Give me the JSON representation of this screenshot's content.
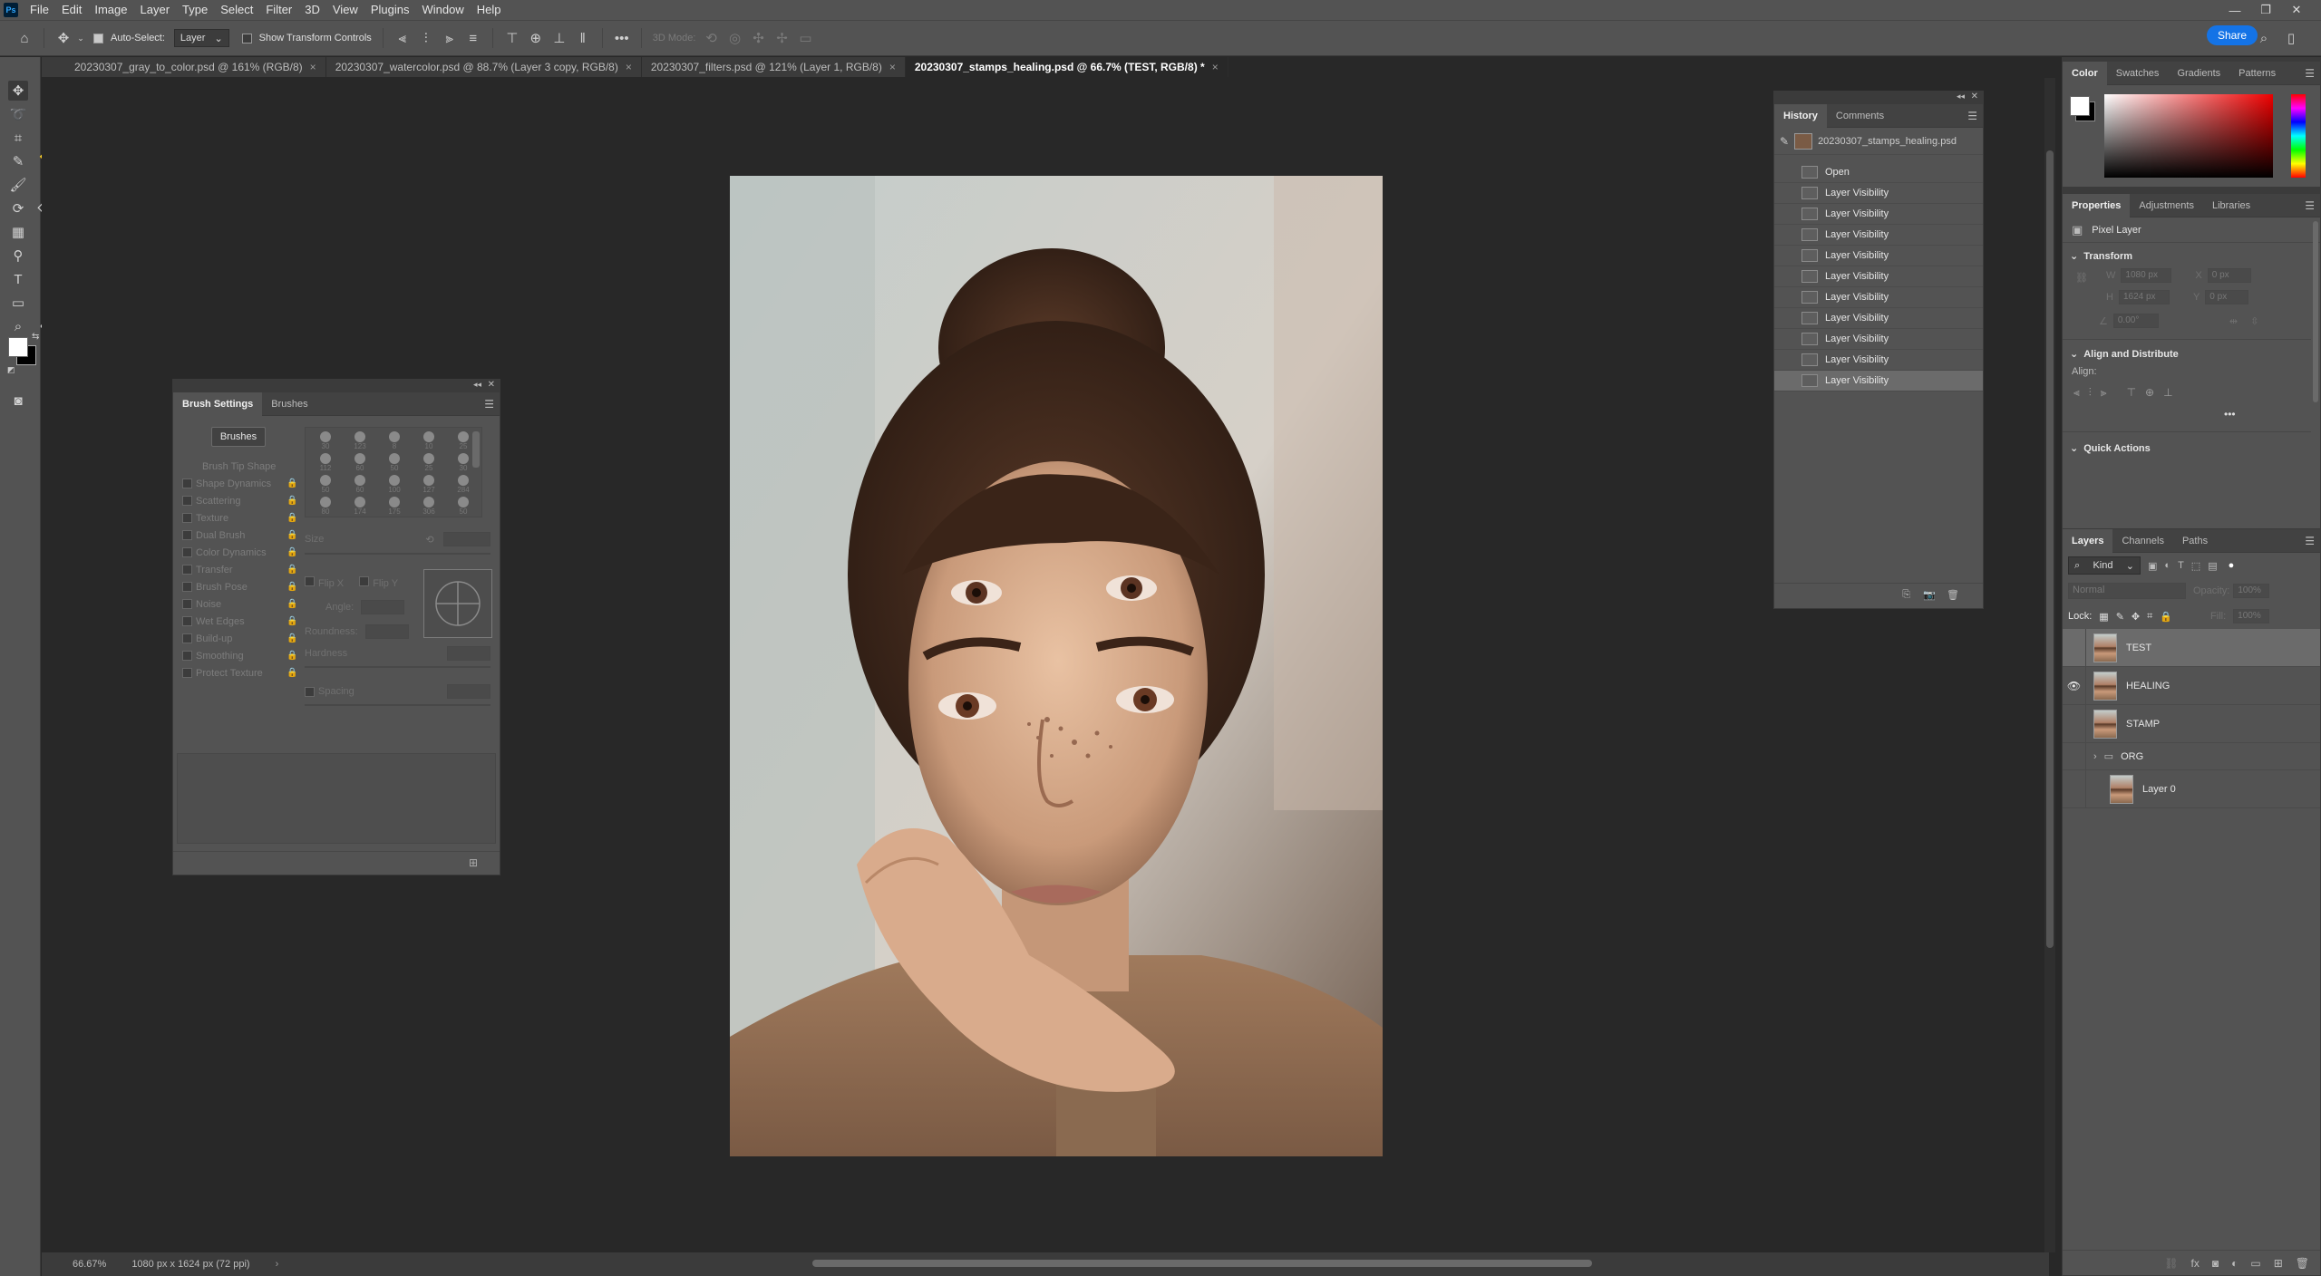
{
  "app": {
    "logo": "Ps"
  },
  "menu": [
    "File",
    "Edit",
    "Image",
    "Layer",
    "Type",
    "Select",
    "Filter",
    "3D",
    "View",
    "Plugins",
    "Window",
    "Help"
  ],
  "options": {
    "auto_select_label": "Auto-Select:",
    "auto_select_value": "Layer",
    "transform_controls_label": "Show Transform Controls",
    "mode_3d_label": "3D Mode:",
    "share_label": "Share"
  },
  "tabs": [
    {
      "label": "20230307_gray_to_color.psd @ 161% (RGB/8)",
      "close": "×"
    },
    {
      "label": "20230307_watercolor.psd @ 88.7% (Layer 3 copy, RGB/8)",
      "close": "×"
    },
    {
      "label": "20230307_filters.psd @ 121% (Layer 1, RGB/8)",
      "close": "×"
    },
    {
      "label": "20230307_stamps_healing.psd @ 66.7% (TEST, RGB/8) *",
      "close": "×"
    }
  ],
  "status": {
    "zoom": "66.67%",
    "doc_info": "1080 px x 1624 px (72 ppi)"
  },
  "history": {
    "tabs": [
      "History",
      "Comments"
    ],
    "snapshot": "20230307_stamps_healing.psd",
    "steps": [
      "Open",
      "Layer Visibility",
      "Layer Visibility",
      "Layer Visibility",
      "Layer Visibility",
      "Layer Visibility",
      "Layer Visibility",
      "Layer Visibility",
      "Layer Visibility",
      "Layer Visibility",
      "Layer Visibility"
    ]
  },
  "brush_settings": {
    "tabs": [
      "Brush Settings",
      "Brushes"
    ],
    "brushes_button": "Brushes",
    "options": [
      "Brush Tip Shape",
      "Shape Dynamics",
      "Scattering",
      "Texture",
      "Dual Brush",
      "Color Dynamics",
      "Transfer",
      "Brush Pose",
      "Noise",
      "Wet Edges",
      "Build-up",
      "Smoothing",
      "Protect Texture"
    ],
    "presets_sizes": [
      "30",
      "123",
      "8",
      "10",
      "25",
      "112",
      "60",
      "50",
      "25",
      "30",
      "50",
      "60",
      "100",
      "127",
      "284",
      "80",
      "174",
      "175",
      "306",
      "50"
    ],
    "size_label": "Size",
    "flip_x": "Flip X",
    "flip_y": "Flip Y",
    "angle_label": "Angle:",
    "roundness_label": "Roundness:",
    "hardness_label": "Hardness",
    "spacing_label": "Spacing"
  },
  "color_panel": {
    "tabs": [
      "Color",
      "Swatches",
      "Gradients",
      "Patterns"
    ]
  },
  "properties": {
    "tabs": [
      "Properties",
      "Adjustments",
      "Libraries"
    ],
    "layer_type": "Pixel Layer",
    "transform_title": "Transform",
    "w_label": "W",
    "w_value": "1080 px",
    "h_label": "H",
    "h_value": "1624 px",
    "x_label": "X",
    "x_value": "0 px",
    "y_label": "Y",
    "y_value": "0 px",
    "angle_value": "0.00°",
    "align_title": "Align and Distribute",
    "align_label": "Align:",
    "quick_actions_title": "Quick Actions",
    "more": "•••"
  },
  "layers": {
    "tabs": [
      "Layers",
      "Channels",
      "Paths"
    ],
    "filter_kind": "Kind",
    "blend_mode": "Normal",
    "opacity_label": "Opacity:",
    "opacity_value": "100%",
    "lock_label": "Lock:",
    "fill_label": "Fill:",
    "fill_value": "100%",
    "items": [
      {
        "name": "TEST",
        "visible": false,
        "selected": true
      },
      {
        "name": "HEALING",
        "visible": true,
        "selected": false
      },
      {
        "name": "STAMP",
        "visible": false,
        "selected": false
      },
      {
        "name": "ORG",
        "visible": false,
        "selected": false,
        "group": true
      },
      {
        "name": "Layer 0",
        "visible": false,
        "selected": false,
        "indent": true
      }
    ]
  },
  "colors": {
    "accent": "#1473e6",
    "panel_bg": "#535353",
    "canvas_bg": "#282828",
    "foreground": "#ffffff",
    "background": "#000000"
  }
}
